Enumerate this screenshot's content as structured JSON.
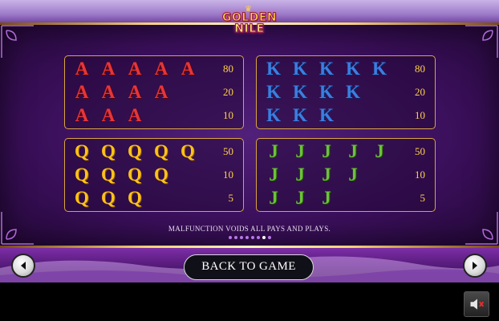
{
  "logo": {
    "line1": "GOLDEN",
    "line2": "NILE"
  },
  "paytable": {
    "A": {
      "symbol": "A",
      "rows": [
        {
          "count": 5,
          "pay": "80"
        },
        {
          "count": 4,
          "pay": "20"
        },
        {
          "count": 3,
          "pay": "10"
        }
      ]
    },
    "K": {
      "symbol": "K",
      "rows": [
        {
          "count": 5,
          "pay": "80"
        },
        {
          "count": 4,
          "pay": "20"
        },
        {
          "count": 3,
          "pay": "10"
        }
      ]
    },
    "Q": {
      "symbol": "Q",
      "rows": [
        {
          "count": 5,
          "pay": "50"
        },
        {
          "count": 4,
          "pay": "10"
        },
        {
          "count": 3,
          "pay": "5"
        }
      ]
    },
    "J": {
      "symbol": "J",
      "rows": [
        {
          "count": 5,
          "pay": "50"
        },
        {
          "count": 4,
          "pay": "10"
        },
        {
          "count": 3,
          "pay": "5"
        }
      ]
    }
  },
  "notice": "MALFUNCTION VOIDS ALL PAYS AND PLAYS.",
  "pagination": {
    "total": 8,
    "current": 7
  },
  "buttons": {
    "back_to_game": "BACK TO GAME",
    "prev_icon": "arrow-left-icon",
    "next_icon": "arrow-right-icon",
    "sound_icon": "speaker-muted-icon"
  },
  "colors": {
    "A": "#e5363a",
    "K": "#3a7fe0",
    "Q": "#ffc21a",
    "J": "#6cc23a",
    "panel_border": "#d9a441",
    "pay_text": "#ffd24a"
  }
}
